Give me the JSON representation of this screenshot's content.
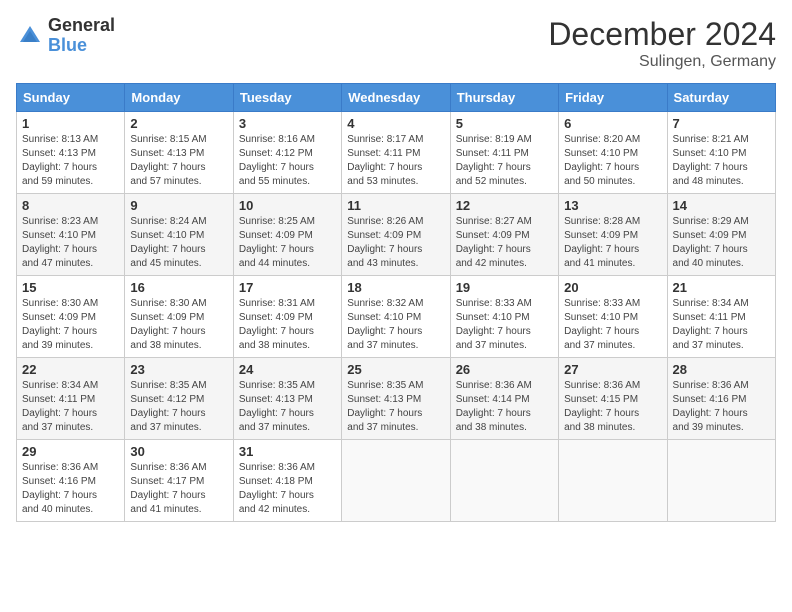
{
  "logo": {
    "text_general": "General",
    "text_blue": "Blue"
  },
  "title": {
    "month": "December 2024",
    "location": "Sulingen, Germany"
  },
  "headers": [
    "Sunday",
    "Monday",
    "Tuesday",
    "Wednesday",
    "Thursday",
    "Friday",
    "Saturday"
  ],
  "weeks": [
    [
      {
        "day": "1",
        "sunrise": "8:13 AM",
        "sunset": "4:13 PM",
        "daylight": "7 hours and 59 minutes."
      },
      {
        "day": "2",
        "sunrise": "8:15 AM",
        "sunset": "4:13 PM",
        "daylight": "7 hours and 57 minutes."
      },
      {
        "day": "3",
        "sunrise": "8:16 AM",
        "sunset": "4:12 PM",
        "daylight": "7 hours and 55 minutes."
      },
      {
        "day": "4",
        "sunrise": "8:17 AM",
        "sunset": "4:11 PM",
        "daylight": "7 hours and 53 minutes."
      },
      {
        "day": "5",
        "sunrise": "8:19 AM",
        "sunset": "4:11 PM",
        "daylight": "7 hours and 52 minutes."
      },
      {
        "day": "6",
        "sunrise": "8:20 AM",
        "sunset": "4:10 PM",
        "daylight": "7 hours and 50 minutes."
      },
      {
        "day": "7",
        "sunrise": "8:21 AM",
        "sunset": "4:10 PM",
        "daylight": "7 hours and 48 minutes."
      }
    ],
    [
      {
        "day": "8",
        "sunrise": "8:23 AM",
        "sunset": "4:10 PM",
        "daylight": "7 hours and 47 minutes."
      },
      {
        "day": "9",
        "sunrise": "8:24 AM",
        "sunset": "4:10 PM",
        "daylight": "7 hours and 45 minutes."
      },
      {
        "day": "10",
        "sunrise": "8:25 AM",
        "sunset": "4:09 PM",
        "daylight": "7 hours and 44 minutes."
      },
      {
        "day": "11",
        "sunrise": "8:26 AM",
        "sunset": "4:09 PM",
        "daylight": "7 hours and 43 minutes."
      },
      {
        "day": "12",
        "sunrise": "8:27 AM",
        "sunset": "4:09 PM",
        "daylight": "7 hours and 42 minutes."
      },
      {
        "day": "13",
        "sunrise": "8:28 AM",
        "sunset": "4:09 PM",
        "daylight": "7 hours and 41 minutes."
      },
      {
        "day": "14",
        "sunrise": "8:29 AM",
        "sunset": "4:09 PM",
        "daylight": "7 hours and 40 minutes."
      }
    ],
    [
      {
        "day": "15",
        "sunrise": "8:30 AM",
        "sunset": "4:09 PM",
        "daylight": "7 hours and 39 minutes."
      },
      {
        "day": "16",
        "sunrise": "8:30 AM",
        "sunset": "4:09 PM",
        "daylight": "7 hours and 38 minutes."
      },
      {
        "day": "17",
        "sunrise": "8:31 AM",
        "sunset": "4:09 PM",
        "daylight": "7 hours and 38 minutes."
      },
      {
        "day": "18",
        "sunrise": "8:32 AM",
        "sunset": "4:10 PM",
        "daylight": "7 hours and 37 minutes."
      },
      {
        "day": "19",
        "sunrise": "8:33 AM",
        "sunset": "4:10 PM",
        "daylight": "7 hours and 37 minutes."
      },
      {
        "day": "20",
        "sunrise": "8:33 AM",
        "sunset": "4:10 PM",
        "daylight": "7 hours and 37 minutes."
      },
      {
        "day": "21",
        "sunrise": "8:34 AM",
        "sunset": "4:11 PM",
        "daylight": "7 hours and 37 minutes."
      }
    ],
    [
      {
        "day": "22",
        "sunrise": "8:34 AM",
        "sunset": "4:11 PM",
        "daylight": "7 hours and 37 minutes."
      },
      {
        "day": "23",
        "sunrise": "8:35 AM",
        "sunset": "4:12 PM",
        "daylight": "7 hours and 37 minutes."
      },
      {
        "day": "24",
        "sunrise": "8:35 AM",
        "sunset": "4:13 PM",
        "daylight": "7 hours and 37 minutes."
      },
      {
        "day": "25",
        "sunrise": "8:35 AM",
        "sunset": "4:13 PM",
        "daylight": "7 hours and 37 minutes."
      },
      {
        "day": "26",
        "sunrise": "8:36 AM",
        "sunset": "4:14 PM",
        "daylight": "7 hours and 38 minutes."
      },
      {
        "day": "27",
        "sunrise": "8:36 AM",
        "sunset": "4:15 PM",
        "daylight": "7 hours and 38 minutes."
      },
      {
        "day": "28",
        "sunrise": "8:36 AM",
        "sunset": "4:16 PM",
        "daylight": "7 hours and 39 minutes."
      }
    ],
    [
      {
        "day": "29",
        "sunrise": "8:36 AM",
        "sunset": "4:16 PM",
        "daylight": "7 hours and 40 minutes."
      },
      {
        "day": "30",
        "sunrise": "8:36 AM",
        "sunset": "4:17 PM",
        "daylight": "7 hours and 41 minutes."
      },
      {
        "day": "31",
        "sunrise": "8:36 AM",
        "sunset": "4:18 PM",
        "daylight": "7 hours and 42 minutes."
      },
      null,
      null,
      null,
      null
    ]
  ],
  "labels": {
    "sunrise": "Sunrise:",
    "sunset": "Sunset:",
    "daylight": "Daylight:"
  }
}
